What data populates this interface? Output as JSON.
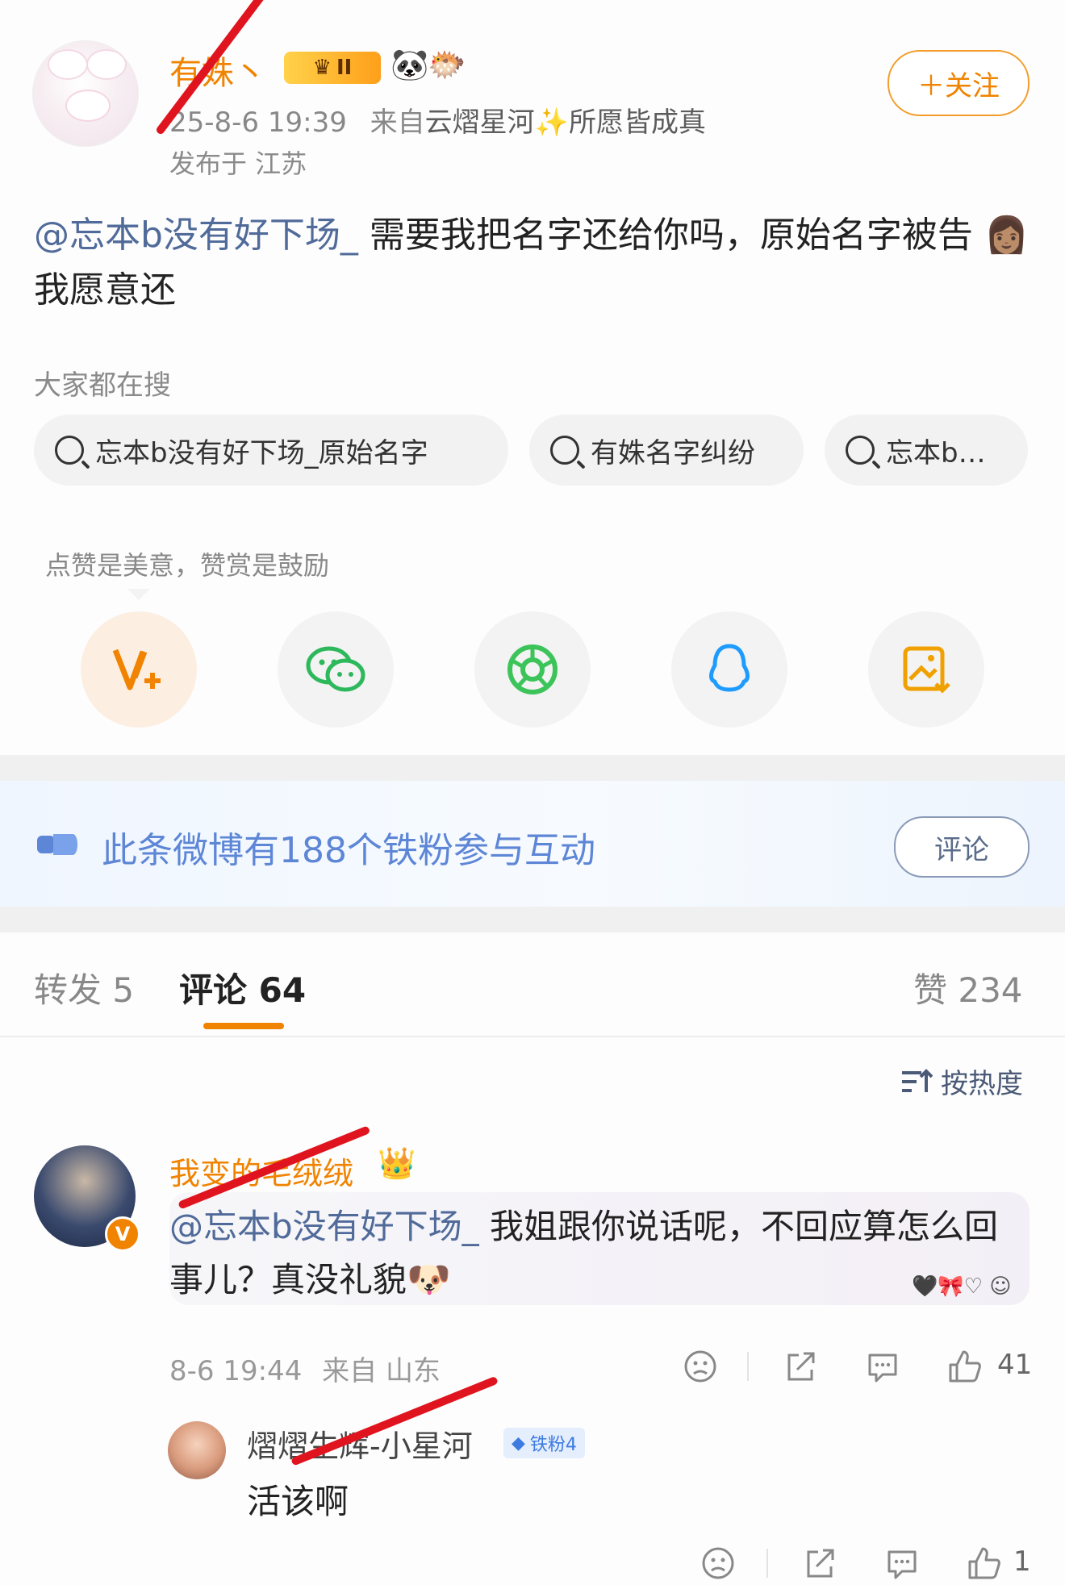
{
  "post": {
    "username": "有姝丶",
    "level_badge": "II",
    "time": "25-8-6 19:39",
    "source_prefix": "来自",
    "source": "云熠星河✨所愿皆成真",
    "location": "发布于 江苏",
    "follow_label": "＋关注",
    "text_mention": "@忘本b没有好下场_",
    "text_body": " 需要我把名字还给你吗，原始名字被告",
    "text_tail": "我愿意还"
  },
  "search": {
    "hint": "大家都在搜",
    "chips": [
      {
        "label": "忘本b没有好下场_原始名字"
      },
      {
        "label": "有姝名字纠纷"
      },
      {
        "label": "忘本b…"
      }
    ]
  },
  "reward": {
    "hint": "点赞是美意，赞赏是鼓励",
    "share_icons": [
      "reward-icon",
      "wechat-icon",
      "moments-icon",
      "qq-icon",
      "save-image-icon"
    ]
  },
  "iron_fans": {
    "text": "此条微博有188个铁粉参与互动",
    "button": "评论"
  },
  "tabs": {
    "repost": "转发 5",
    "comment": "评论 64",
    "like": "赞 234"
  },
  "sort_label": "按热度",
  "comment": {
    "name": "我变的毛绒绒",
    "v_badge": "V",
    "mention": "@忘本b没有好下场_",
    "text": " 我姐跟你说话呢，不回应算怎么回事儿？真没礼貌",
    "time": "8-6 19:44",
    "source": "来自 山东",
    "likes": "41"
  },
  "reply": {
    "name": "熠熠生辉-小星河",
    "badge": "铁粉4",
    "text": "活该啊",
    "likes": "1"
  },
  "colors": {
    "brand_orange": "#f08300",
    "mention_blue": "#506a99",
    "iron_blue": "#5d86d6",
    "redaction": "#e0141e"
  }
}
